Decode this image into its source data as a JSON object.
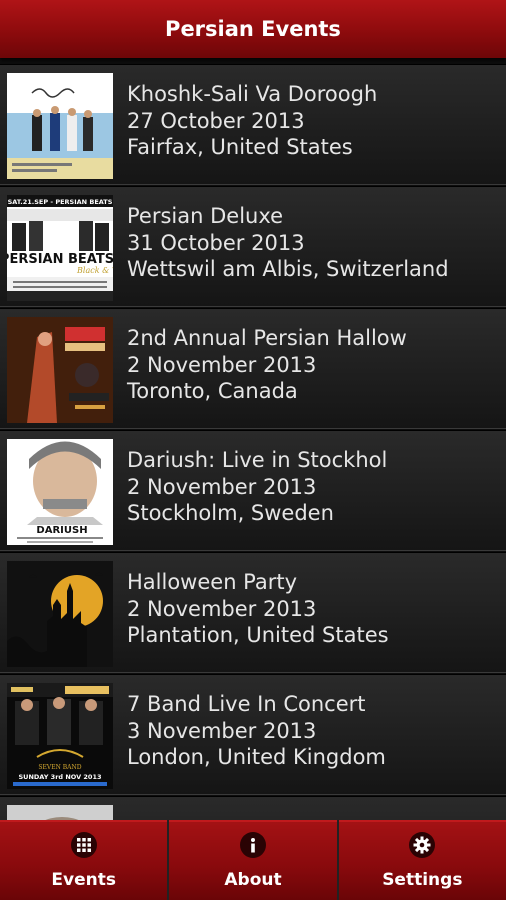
{
  "header": {
    "title": "Persian Events"
  },
  "events": [
    {
      "title": "Khoshk-Sali Va Doroogh",
      "date": "27 October 2013",
      "location": "Fairfax, United States"
    },
    {
      "title": "Persian Deluxe",
      "date": "31 October 2013",
      "location": "Wettswil am Albis, Switzerland"
    },
    {
      "title": "2nd Annual Persian Hallow",
      "date": "2 November 2013",
      "location": "Toronto, Canada"
    },
    {
      "title": "Dariush: Live in Stockhol",
      "date": "2 November 2013",
      "location": "Stockholm, Sweden"
    },
    {
      "title": "Halloween Party",
      "date": "2 November 2013",
      "location": "Plantation, United States"
    },
    {
      "title": "7 Band Live In Concert",
      "date": "3 November 2013",
      "location": "London, United Kingdom"
    }
  ],
  "poster_text": {
    "persian_deluxe_top": "SAT.21.SEP - PERSIAN BEATS",
    "persian_deluxe_logo": "PERSIAN BEATS",
    "dariush_name": "DARIUSH",
    "seven_band_date": "SUNDAY 3rd NOV 2013"
  },
  "tabs": [
    {
      "label": "Events",
      "icon": "grid-icon"
    },
    {
      "label": "About",
      "icon": "info-icon"
    },
    {
      "label": "Settings",
      "icon": "gear-icon"
    }
  ],
  "colors": {
    "accent": "#8a0a0c",
    "text": "#e6e6e6"
  }
}
